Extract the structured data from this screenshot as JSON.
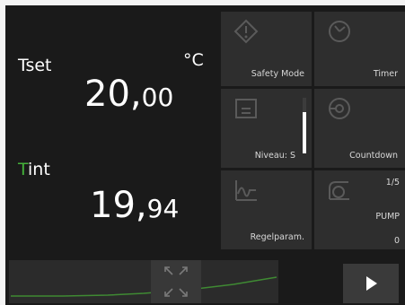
{
  "left_panel": {
    "tset_label": "Tset",
    "unit": "°C",
    "tset_int": "20,",
    "tset_dec": "00",
    "tint_label_first": "T",
    "tint_label_rest": "int",
    "tint_int": "19,",
    "tint_dec": "94",
    "accent_color": "#44b13a"
  },
  "tiles": {
    "safety": {
      "label": "Safety Mode",
      "icon": "warning-icon"
    },
    "timer": {
      "label": "Timer",
      "icon": "clock-icon"
    },
    "niveau": {
      "label": "Niveau: S",
      "icon": "tank-icon",
      "level_fraction": 0.75
    },
    "countdown": {
      "label": "Countdown",
      "icon": "countdown-icon"
    },
    "regelparam": {
      "label": "Regelparam.",
      "icon": "curve-icon"
    },
    "pump": {
      "label": "PUMP",
      "corner": "1/5",
      "value": "0",
      "icon": "pump-icon"
    }
  },
  "bottom": {
    "chart_icon": "trend-chart-icon",
    "expand_icon": "expand-arrows-icon",
    "play_icon": "play-icon"
  }
}
